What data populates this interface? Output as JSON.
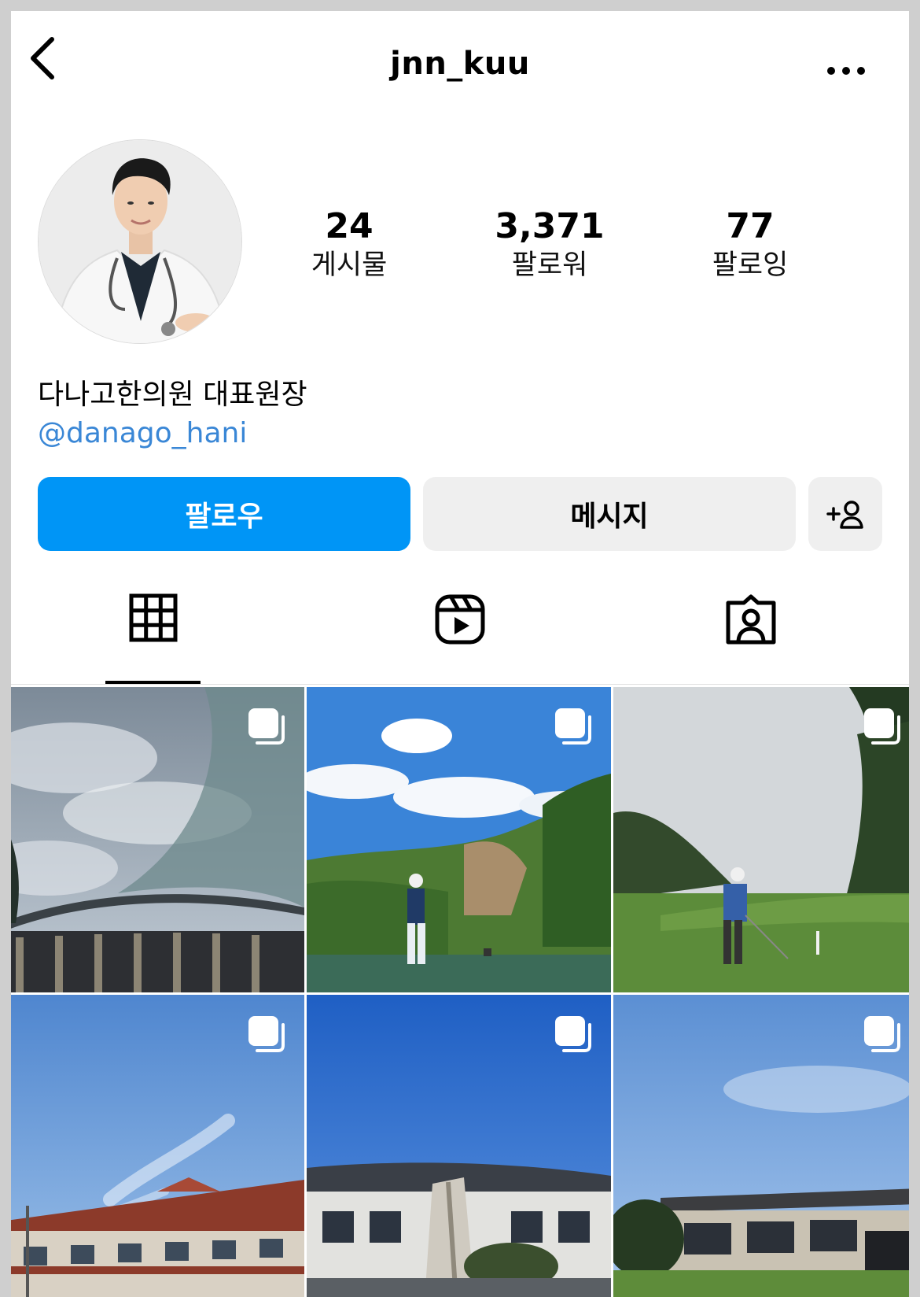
{
  "header": {
    "username": "jnn_kuu",
    "back_icon": "chevron-left-icon",
    "more_icon": "more-horizontal-icon"
  },
  "profile": {
    "stats": [
      {
        "value": "24",
        "label": "게시물"
      },
      {
        "value": "3,371",
        "label": "팔로워"
      },
      {
        "value": "77",
        "label": "팔로잉"
      }
    ],
    "bio_name": "다나고한의원 대표원장",
    "bio_link": "@danago_hani"
  },
  "actions": {
    "follow_label": "팔로우",
    "message_label": "메시지",
    "suggest_icon": "add-person-icon"
  },
  "tabs": [
    {
      "name": "posts",
      "icon": "grid-icon",
      "active": true
    },
    {
      "name": "reels",
      "icon": "reels-icon",
      "active": false
    },
    {
      "name": "tagged",
      "icon": "tagged-person-icon",
      "active": false
    }
  ],
  "grid": {
    "posts": [
      {
        "scene": "clubhouse-roof-sky",
        "multi": true
      },
      {
        "scene": "golfer-teeing-off-valley",
        "multi": true
      },
      {
        "scene": "golfer-fairway",
        "multi": true
      },
      {
        "scene": "clubhouse-blue-sky",
        "multi": true
      },
      {
        "scene": "traditional-clubhouse",
        "multi": true
      },
      {
        "scene": "modern-clubhouse",
        "multi": true
      }
    ]
  },
  "colors": {
    "accent": "#0095f6",
    "link": "#3a87d6",
    "button_bg": "#efefef"
  }
}
